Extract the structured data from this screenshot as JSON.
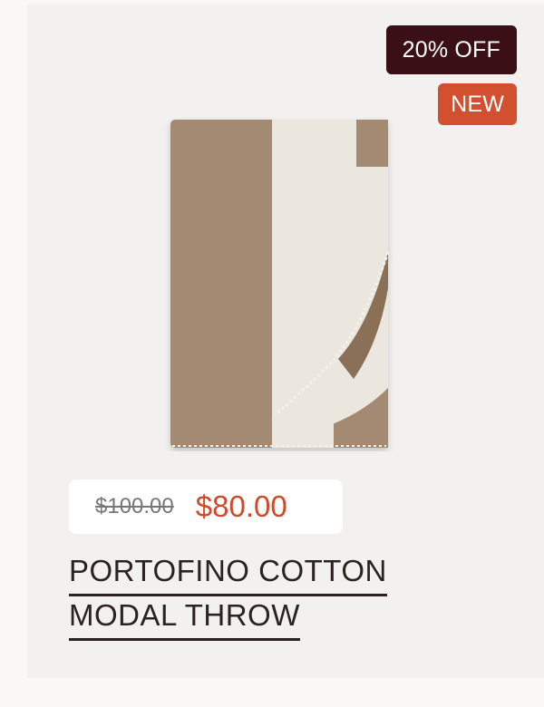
{
  "badges": {
    "sale": "20% OFF",
    "new": "NEW"
  },
  "product": {
    "image_icon": "folded-throw-blanket-image",
    "price_original": "$100.00",
    "price_sale": "$80.00",
    "title_line1": "PORTOFINO COTTON",
    "title_line2": "MODAL THROW"
  },
  "colors": {
    "sale_badge": "#3a1016",
    "new_badge": "#d24f30",
    "sale_price": "#cf4a2c",
    "blanket_brown": "#a48a72",
    "blanket_cream": "#ece8e0"
  }
}
